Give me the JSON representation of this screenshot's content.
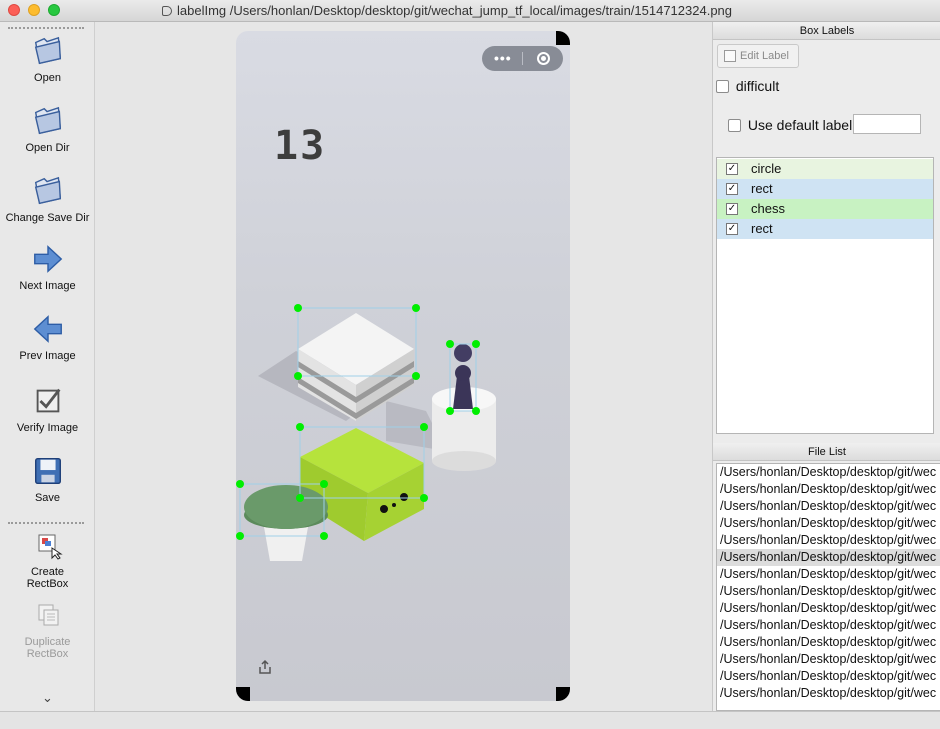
{
  "window": {
    "title": "labelImg /Users/honlan/Desktop/desktop/git/wechat_jump_tf_local/images/train/1514712324.png"
  },
  "toolbar": {
    "items": [
      {
        "label": "Open",
        "icon": "folder-open-icon"
      },
      {
        "label": "Open Dir",
        "icon": "folder-open-icon"
      },
      {
        "label": "Change Save Dir",
        "icon": "folder-open-icon"
      },
      {
        "label": "Next Image",
        "icon": "arrow-right-icon"
      },
      {
        "label": "Prev Image",
        "icon": "arrow-left-icon"
      },
      {
        "label": "Verify Image",
        "icon": "checkbox-icon"
      },
      {
        "label": "Save",
        "icon": "floppy-disk-icon"
      },
      {
        "label": "Create\nRectBox",
        "icon": "create-rectbox-icon"
      },
      {
        "label": "Duplicate\nRectBox",
        "icon": "duplicate-icon"
      }
    ],
    "more_icon": "chevron-double-down-icon"
  },
  "canvas": {
    "score": "13",
    "capsule_more": "•••",
    "share_icon": "share-icon"
  },
  "box_labels": {
    "panel_title": "Box Labels",
    "edit_label": "Edit Label",
    "difficult_label": "difficult",
    "use_default_label": "Use default label",
    "default_label_value": "",
    "labels": [
      {
        "text": "circle",
        "checked": true,
        "bg": "#e8f4e0"
      },
      {
        "text": "rect",
        "checked": true,
        "bg": "#cfe3f3"
      },
      {
        "text": "chess",
        "checked": true,
        "bg": "#c8f2c2"
      },
      {
        "text": "rect",
        "checked": true,
        "bg": "#cfe3f3"
      }
    ]
  },
  "file_list": {
    "panel_title": "File List",
    "files": [
      "/Users/honlan/Desktop/desktop/git/wec",
      "/Users/honlan/Desktop/desktop/git/wec",
      "/Users/honlan/Desktop/desktop/git/wec",
      "/Users/honlan/Desktop/desktop/git/wec",
      "/Users/honlan/Desktop/desktop/git/wec",
      "/Users/honlan/Desktop/desktop/git/wec",
      "/Users/honlan/Desktop/desktop/git/wec",
      "/Users/honlan/Desktop/desktop/git/wec",
      "/Users/honlan/Desktop/desktop/git/wec",
      "/Users/honlan/Desktop/desktop/git/wec",
      "/Users/honlan/Desktop/desktop/git/wec",
      "/Users/honlan/Desktop/desktop/git/wec",
      "/Users/honlan/Desktop/desktop/git/wec",
      "/Users/honlan/Desktop/desktop/git/wec"
    ],
    "selected_index": 5
  },
  "colors": {
    "handle": "#00ee00",
    "box_stroke": "#9fd0e8",
    "selected_row": "#dcdcdc"
  }
}
